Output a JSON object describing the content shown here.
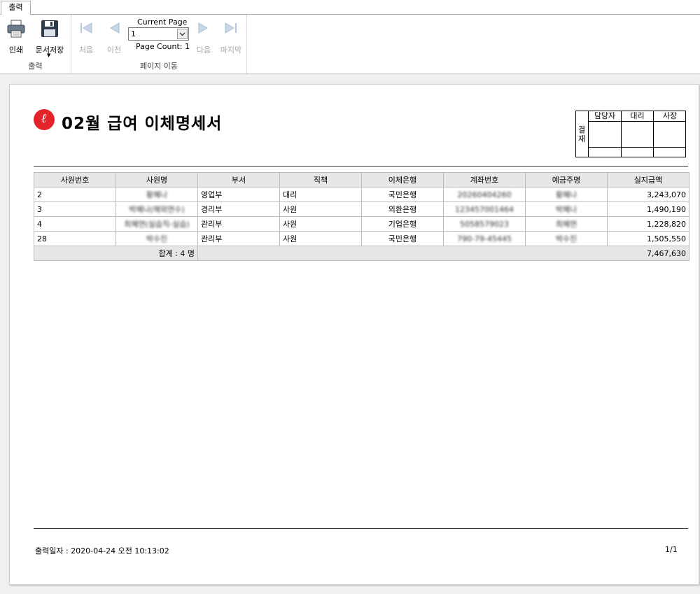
{
  "ribbon": {
    "tab": "출력",
    "print_label": "인쇄",
    "save_label": "문서저장",
    "group_output": "출력",
    "first_label": "처음",
    "prev_label": "이전",
    "next_label": "다음",
    "last_label": "마지막",
    "current_page_label": "Current Page",
    "current_page_value": "1",
    "page_count_label": "Page Count: 1",
    "group_nav": "페이지 이동"
  },
  "report": {
    "logo_char": "ℓ",
    "title": "02월 급여 이체명세서",
    "approval": {
      "side": "결재",
      "cols": [
        "담당자",
        "대리",
        "사장"
      ]
    },
    "columns": [
      "사원번호",
      "사원명",
      "부서",
      "직책",
      "이체은행",
      "계좌번호",
      "예금주명",
      "실지급액"
    ],
    "rows": [
      {
        "no": "2",
        "name": "황혜나",
        "dept": "영업부",
        "pos": "대리",
        "bank": "국민은행",
        "account": "20260404260",
        "holder": "황혜나",
        "amount": "3,243,070"
      },
      {
        "no": "3",
        "name": "박혜나(해외연수)",
        "dept": "경리부",
        "pos": "사원",
        "bank": "외환은행",
        "account": "123457001464",
        "holder": "박혜나",
        "amount": "1,490,190"
      },
      {
        "no": "4",
        "name": "최혜연(실습직-실습)",
        "dept": "관리부",
        "pos": "사원",
        "bank": "기업은행",
        "account": "5058579023",
        "holder": "최혜연",
        "amount": "1,228,820"
      },
      {
        "no": "28",
        "name": "박수진",
        "dept": "관리부",
        "pos": "사원",
        "bank": "국민은행",
        "account": "790-79-45445",
        "holder": "박수진",
        "amount": "1,505,550"
      }
    ],
    "total_label": "합계 : 4 명",
    "total_amount": "7,467,630",
    "print_date": "출력일자 :  2020-04-24 오전 10:13:02",
    "page_indicator": "1/1"
  }
}
